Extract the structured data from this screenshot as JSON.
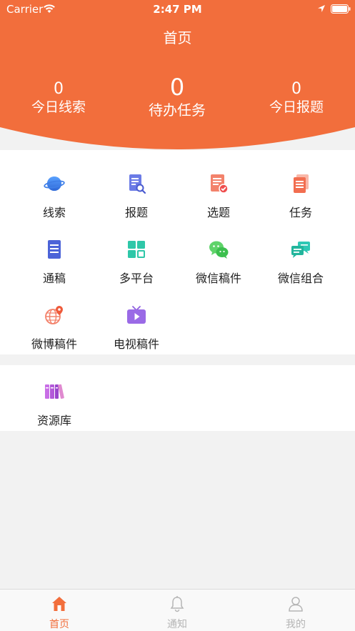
{
  "status_bar": {
    "carrier": "Carrier",
    "time": "2:47 PM"
  },
  "header": {
    "title": "首页",
    "color": "#f26e3c",
    "stats": {
      "left": {
        "value": "0",
        "label": "今日线索"
      },
      "mid": {
        "value": "0",
        "label": "待办任务"
      },
      "right": {
        "value": "0",
        "label": "今日报题"
      }
    }
  },
  "grid": {
    "items": [
      {
        "label": "线索",
        "icon": "planet-icon"
      },
      {
        "label": "报题",
        "icon": "document-search-icon"
      },
      {
        "label": "选题",
        "icon": "document-check-icon"
      },
      {
        "label": "任务",
        "icon": "task-stack-icon"
      },
      {
        "label": "通稿",
        "icon": "document-icon"
      },
      {
        "label": "多平台",
        "icon": "grid-squares-icon"
      },
      {
        "label": "微信稿件",
        "icon": "wechat-icon"
      },
      {
        "label": "微信组合",
        "icon": "chat-bubbles-icon"
      },
      {
        "label": "微博稿件",
        "icon": "globe-pin-icon"
      },
      {
        "label": "电视稿件",
        "icon": "tv-play-icon"
      }
    ]
  },
  "library": {
    "label": "资源库",
    "icon": "books-icon"
  },
  "tabbar": {
    "tabs": [
      {
        "label": "首页",
        "icon": "home-icon",
        "active": true
      },
      {
        "label": "通知",
        "icon": "bell-icon",
        "active": false
      },
      {
        "label": "我的",
        "icon": "person-icon",
        "active": false
      }
    ]
  }
}
